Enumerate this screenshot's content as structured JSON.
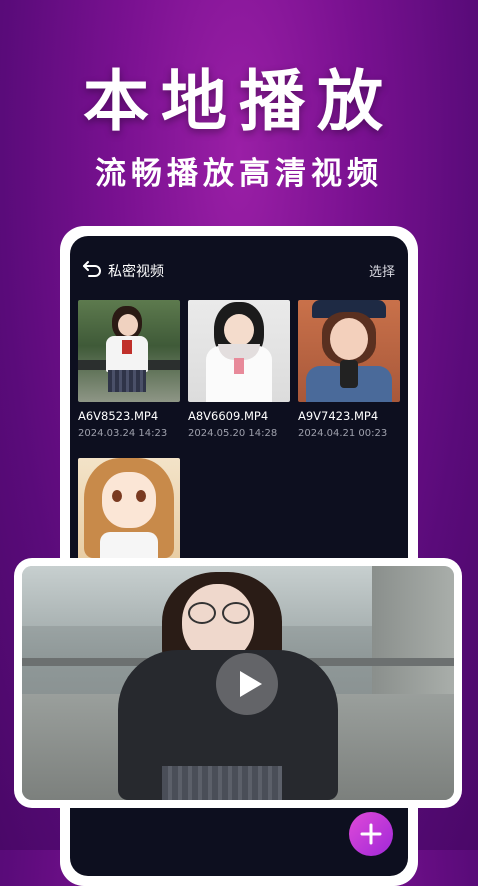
{
  "banner": {
    "title": "本地播放",
    "subtitle": "流畅播放高清视频"
  },
  "app": {
    "header": {
      "back_icon": "back-arrow-icon",
      "title": "私密视频",
      "select_label": "选择"
    },
    "videos": [
      {
        "filename": "A6V8523.MP4",
        "date": "2024.03.24  14:23"
      },
      {
        "filename": "A8V6609.MP4",
        "date": "2024.05.20  14:28"
      },
      {
        "filename": "A9V7423.MP4",
        "date": "2024.04.21  00:23"
      },
      {
        "filename": "",
        "date": ""
      }
    ],
    "player": {
      "play_icon": "play-icon"
    },
    "add_button": {
      "icon": "plus-icon"
    }
  },
  "colors": {
    "background": "#7a1191",
    "screen": "#0d0f1f",
    "accent": "#c83ad8"
  }
}
